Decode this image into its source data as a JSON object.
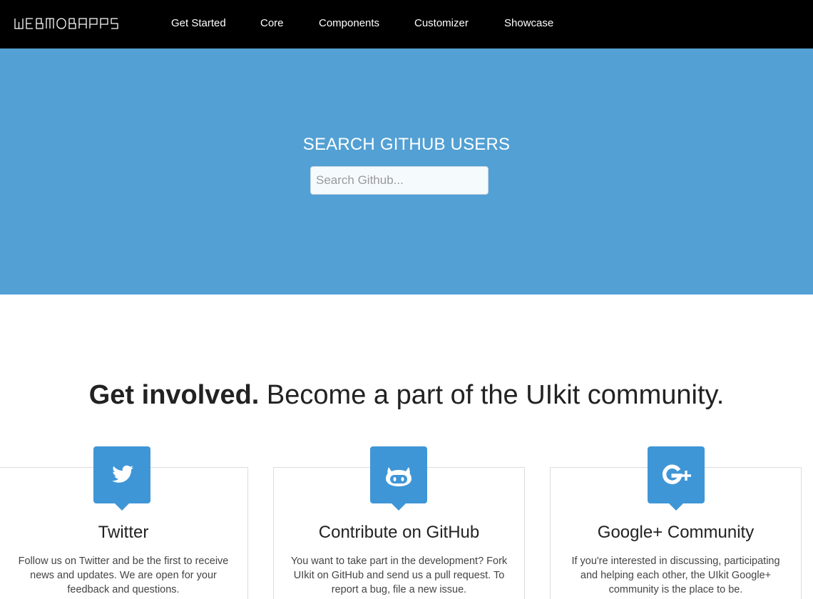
{
  "nav": {
    "logo_text": "WEBMOBAPPS",
    "items": [
      {
        "label": "Get Started"
      },
      {
        "label": "Core"
      },
      {
        "label": "Components"
      },
      {
        "label": "Customizer"
      },
      {
        "label": "Showcase"
      }
    ]
  },
  "hero": {
    "title": "SEARCH GITHUB USERS",
    "search_placeholder": "Search Github...",
    "search_value": ""
  },
  "headline": {
    "bold": "Get involved.",
    "rest": "Become a part of the UIkit community."
  },
  "panels": [
    {
      "icon": "twitter-icon",
      "title": "Twitter",
      "text": "Follow us on Twitter and be the first to receive news and updates. We are open for your feedback and questions."
    },
    {
      "icon": "github-icon",
      "title": "Contribute on GitHub",
      "text": "You want to take part in the development? Fork UIkit on GitHub and send us a pull request. To report a bug, file a new issue."
    },
    {
      "icon": "google-plus-icon",
      "title": "Google+ Community",
      "text": "If you're interested in discussing, participating and helping each other, the UIkit Google+ community is the place to be."
    }
  ],
  "colors": {
    "navbar": "#000000",
    "hero": "#52a0d4",
    "icon_badge": "#3f96d6"
  }
}
